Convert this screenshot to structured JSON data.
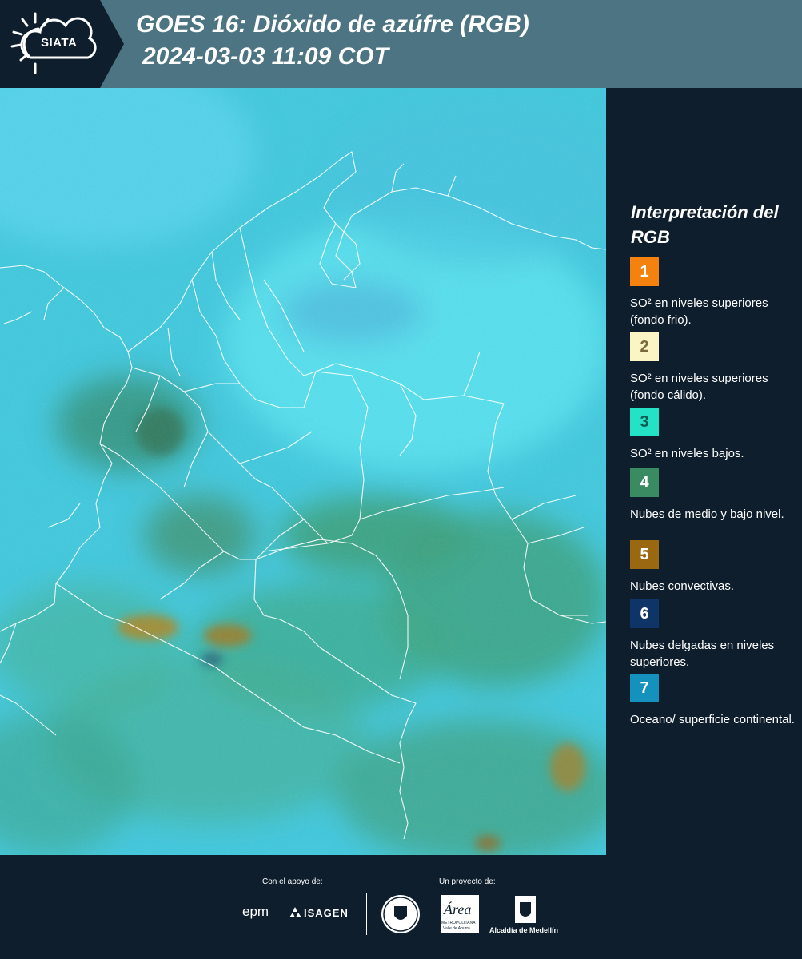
{
  "header": {
    "logo_text": "SIATA",
    "title_line1": "GOES 16: Dióxido de azúfre (RGB)",
    "title_line2": "2024-03-03 11:09 COT"
  },
  "legend": {
    "title": "Interpretación del RGB",
    "items": [
      {
        "number": "1",
        "color": "#f5820f",
        "number_color": "#ffffff",
        "text": "SO² en niveles superiores (fondo frio)."
      },
      {
        "number": "2",
        "color": "#fbf5c6",
        "number_color": "#7a6b3c",
        "text": "SO² en niveles superiores (fondo cálido)."
      },
      {
        "number": "3",
        "color": "#23e2c5",
        "number_color": "#0e5a52",
        "text": "SO² en niveles bajos."
      },
      {
        "number": "4",
        "color": "#3a8b62",
        "number_color": "#ffffff",
        "text": "Nubes de medio y bajo nivel."
      },
      {
        "number": "5",
        "color": "#9a6811",
        "number_color": "#ffffff",
        "text": "Nubes convectivas."
      },
      {
        "number": "6",
        "color": "#0e3468",
        "number_color": "#ffffff",
        "text": "Nubes delgadas en niveles superiores."
      },
      {
        "number": "7",
        "color": "#1491bd",
        "number_color": "#ffffff",
        "text": "Oceano/ superficie continental."
      }
    ]
  },
  "footer": {
    "support_label": "Con el apoyo de:",
    "project_label": "Un proyecto de:",
    "epm": "epm",
    "isagen": "ISAGEN",
    "area_name": "Área",
    "area_sub": "METROPOLITANA",
    "area_sub2": "Valle de Aburrá",
    "alcaldia": "Alcaldía de Medellín",
    "seal_text": "MEDELLÍN"
  },
  "colors": {
    "background": "#0e1e2c",
    "header": "#4d7482",
    "map_cyan": "#3fd2e6",
    "map_green": "#3a8b62",
    "border_line": "#ffffff"
  }
}
